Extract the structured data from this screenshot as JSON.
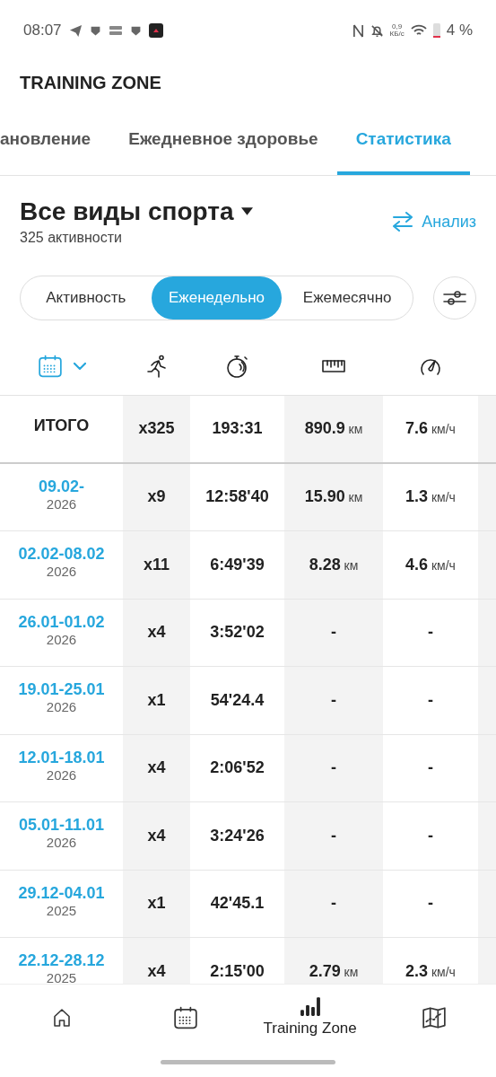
{
  "status_bar": {
    "time": "08:07",
    "speed_value": "0,9",
    "speed_unit": "КБ/с",
    "battery": "4 %"
  },
  "header": {
    "title": "TRAINING ZONE"
  },
  "tabs": [
    {
      "label": "ановление",
      "selected": false
    },
    {
      "label": "Ежедневное здоровье",
      "selected": false
    },
    {
      "label": "Статистика",
      "selected": true
    }
  ],
  "sport": {
    "title": "Все виды спорта",
    "subtitle": "325 активности",
    "analysis": "Анализ"
  },
  "segments": [
    {
      "label": "Активность",
      "selected": false
    },
    {
      "label": "Еженедельно",
      "selected": true
    },
    {
      "label": "Ежемесячно",
      "selected": false
    }
  ],
  "total": {
    "label": "ИТОГО",
    "count": "x325",
    "time": "193:31",
    "distance": "890.9",
    "distance_unit": "км",
    "speed": "7.6",
    "speed_unit": "км/ч"
  },
  "rows": [
    {
      "date": "09.02-",
      "year": "2026",
      "count": "x9",
      "time": "12:58'40",
      "distance": "15.90",
      "distance_unit": "км",
      "speed": "1.3",
      "speed_unit": "км/ч"
    },
    {
      "date": "02.02-08.02",
      "year": "2026",
      "count": "x11",
      "time": "6:49'39",
      "distance": "8.28",
      "distance_unit": "км",
      "speed": "4.6",
      "speed_unit": "км/ч"
    },
    {
      "date": "26.01-01.02",
      "year": "2026",
      "count": "x4",
      "time": "3:52'02",
      "distance": "-",
      "speed": "-"
    },
    {
      "date": "19.01-25.01",
      "year": "2026",
      "count": "x1",
      "time": "54'24.4",
      "distance": "-",
      "speed": "-"
    },
    {
      "date": "12.01-18.01",
      "year": "2026",
      "count": "x4",
      "time": "2:06'52",
      "distance": "-",
      "speed": "-"
    },
    {
      "date": "05.01-11.01",
      "year": "2026",
      "count": "x4",
      "time": "3:24'26",
      "distance": "-",
      "speed": "-"
    },
    {
      "date": "29.12-04.01",
      "year": "2025",
      "count": "x1",
      "time": "42'45.1",
      "distance": "-",
      "speed": "-"
    },
    {
      "date": "22.12-28.12",
      "year": "2025",
      "count": "x4",
      "time": "2:15'00",
      "distance": "2.79",
      "distance_unit": "км",
      "speed": "2.3",
      "speed_unit": "км/ч"
    }
  ],
  "nav": [
    {
      "kind": "home",
      "selected": false
    },
    {
      "kind": "calendar",
      "selected": false
    },
    {
      "kind": "stats",
      "selected": true,
      "label": "Training Zone"
    },
    {
      "kind": "map",
      "selected": false
    }
  ]
}
